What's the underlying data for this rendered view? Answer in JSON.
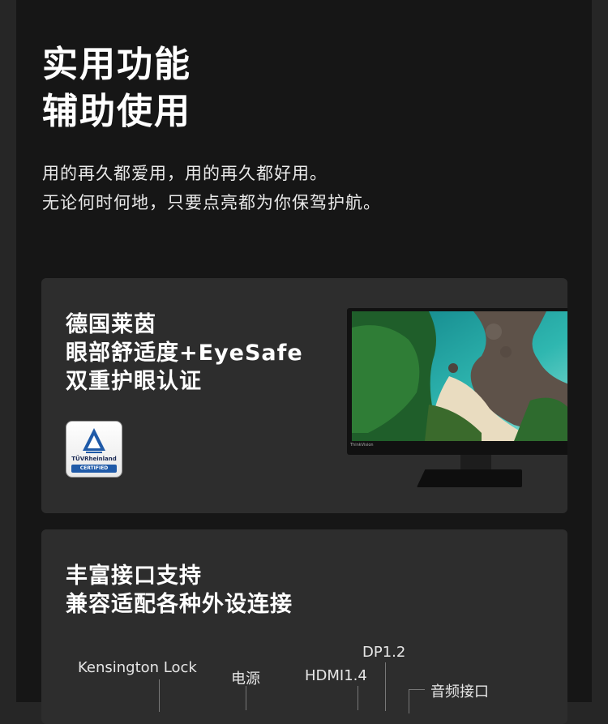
{
  "header": {
    "headline_line1": "实用功能",
    "headline_line2": "辅助使用",
    "sub_line1": "用的再久都爱用，用的再久都好用。",
    "sub_line2": "无论何时何地，只要点亮都为你保驾护航。"
  },
  "card_eye": {
    "title_line1": "德国莱茵",
    "title_line2": "眼部舒适度+EyeSafe",
    "title_line3": "双重护眼认证",
    "badge_name": "TÜVRheinland",
    "badge_label": "CERTIFIED",
    "monitor_brand": "ThinkVision"
  },
  "card_ports": {
    "title_line1": "丰富接口支持",
    "title_line2": "兼容适配各种外设连接",
    "ports": [
      "Kensington Lock",
      "电源",
      "HDMI1.4",
      "DP1.2",
      "音频接口"
    ]
  },
  "colors": {
    "page_bg": "#161616",
    "card_bg": "#2d2d2d",
    "badge_blue": "#1f5aa8"
  }
}
